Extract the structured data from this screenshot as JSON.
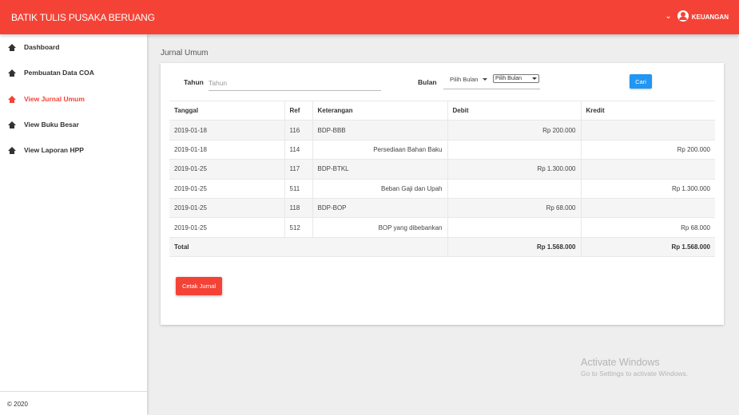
{
  "app": {
    "brand": "BATIK TULIS PUSAKA BERUANG"
  },
  "user_menu": {
    "label": "KEUANGAN",
    "chevron_icon": "chevron-down-icon",
    "user_icon": "user-circle-icon"
  },
  "sidebar": {
    "items": [
      {
        "label": "Dashboard",
        "icon": "home-icon",
        "active": false
      },
      {
        "label": "Pembuatan Data COA",
        "icon": "home-icon",
        "active": false
      },
      {
        "label": "View Jurnal Umum",
        "icon": "home-icon",
        "active": true
      },
      {
        "label": "View Buku Besar",
        "icon": "home-icon",
        "active": false
      },
      {
        "label": "View Laporan HPP",
        "icon": "home-icon",
        "active": false
      }
    ],
    "footer": "© 2020"
  },
  "page": {
    "title": "Jurnal Umum"
  },
  "filters": {
    "tahun_label": "Tahun",
    "tahun_placeholder": "Tahun",
    "tahun_value": "",
    "bulan_label": "Bulan",
    "bulan_selected": "Pilih Bulan",
    "bulan_native_selected": "Pilih Bulan",
    "cari_label": "Cari"
  },
  "table": {
    "headers": [
      "Tanggal",
      "Ref",
      "Keterangan",
      "Debit",
      "Kredit"
    ],
    "rows": [
      {
        "tanggal": "2019-01-18",
        "ref": "116",
        "keterangan": "BDP-BBB",
        "debit": "Rp 200.000",
        "kredit": ""
      },
      {
        "tanggal": "2019-01-18",
        "ref": "114",
        "keterangan": "Persediaan Bahan Baku",
        "debit": "",
        "kredit": "Rp 200.000"
      },
      {
        "tanggal": "2019-01-25",
        "ref": "117",
        "keterangan": "BDP-BTKL",
        "debit": "Rp 1.300.000",
        "kredit": ""
      },
      {
        "tanggal": "2019-01-25",
        "ref": "511",
        "keterangan": "Beban Gaji dan Upah",
        "debit": "",
        "kredit": "Rp 1.300.000"
      },
      {
        "tanggal": "2019-01-25",
        "ref": "118",
        "keterangan": "BDP-BOP",
        "debit": "Rp 68.000",
        "kredit": ""
      },
      {
        "tanggal": "2019-01-25",
        "ref": "512",
        "keterangan": "BOP yang dibebankan",
        "debit": "",
        "kredit": "Rp 68.000"
      }
    ],
    "total": {
      "label": "Total",
      "debit": "Rp 1.568.000",
      "kredit": "Rp 1.568.000"
    }
  },
  "actions": {
    "cetak_label": "Cetak Jurnal"
  },
  "watermark": {
    "title": "Activate Windows",
    "subtitle": "Go to Settings to activate Windows."
  },
  "colors": {
    "primary": "#f44336",
    "button_blue": "#2196f3",
    "background": "#eeeeee"
  }
}
